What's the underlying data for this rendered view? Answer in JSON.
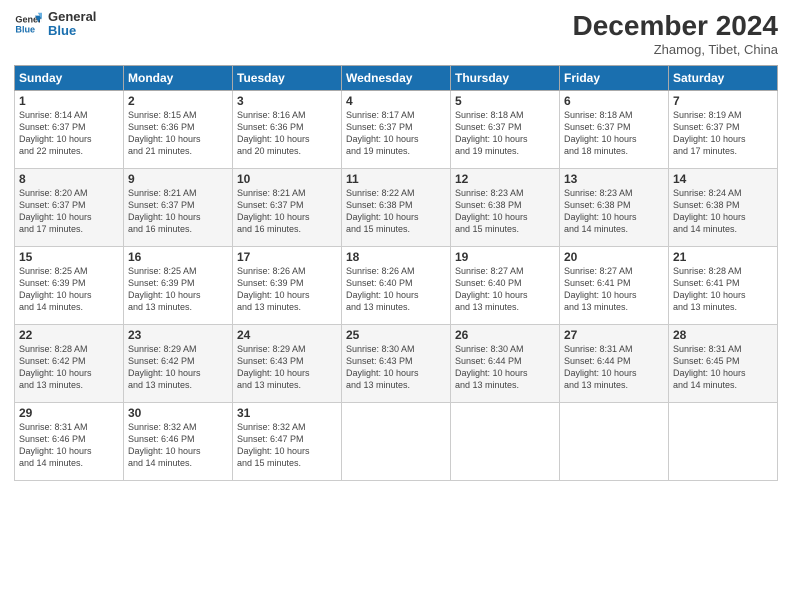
{
  "logo": {
    "line1": "General",
    "line2": "Blue"
  },
  "title": "December 2024",
  "subtitle": "Zhamog, Tibet, China",
  "days_header": [
    "Sunday",
    "Monday",
    "Tuesday",
    "Wednesday",
    "Thursday",
    "Friday",
    "Saturday"
  ],
  "weeks": [
    [
      {
        "day": "1",
        "text": "Sunrise: 8:14 AM\nSunset: 6:37 PM\nDaylight: 10 hours\nand 22 minutes."
      },
      {
        "day": "2",
        "text": "Sunrise: 8:15 AM\nSunset: 6:36 PM\nDaylight: 10 hours\nand 21 minutes."
      },
      {
        "day": "3",
        "text": "Sunrise: 8:16 AM\nSunset: 6:36 PM\nDaylight: 10 hours\nand 20 minutes."
      },
      {
        "day": "4",
        "text": "Sunrise: 8:17 AM\nSunset: 6:37 PM\nDaylight: 10 hours\nand 19 minutes."
      },
      {
        "day": "5",
        "text": "Sunrise: 8:18 AM\nSunset: 6:37 PM\nDaylight: 10 hours\nand 19 minutes."
      },
      {
        "day": "6",
        "text": "Sunrise: 8:18 AM\nSunset: 6:37 PM\nDaylight: 10 hours\nand 18 minutes."
      },
      {
        "day": "7",
        "text": "Sunrise: 8:19 AM\nSunset: 6:37 PM\nDaylight: 10 hours\nand 17 minutes."
      }
    ],
    [
      {
        "day": "8",
        "text": "Sunrise: 8:20 AM\nSunset: 6:37 PM\nDaylight: 10 hours\nand 17 minutes."
      },
      {
        "day": "9",
        "text": "Sunrise: 8:21 AM\nSunset: 6:37 PM\nDaylight: 10 hours\nand 16 minutes."
      },
      {
        "day": "10",
        "text": "Sunrise: 8:21 AM\nSunset: 6:37 PM\nDaylight: 10 hours\nand 16 minutes."
      },
      {
        "day": "11",
        "text": "Sunrise: 8:22 AM\nSunset: 6:38 PM\nDaylight: 10 hours\nand 15 minutes."
      },
      {
        "day": "12",
        "text": "Sunrise: 8:23 AM\nSunset: 6:38 PM\nDaylight: 10 hours\nand 15 minutes."
      },
      {
        "day": "13",
        "text": "Sunrise: 8:23 AM\nSunset: 6:38 PM\nDaylight: 10 hours\nand 14 minutes."
      },
      {
        "day": "14",
        "text": "Sunrise: 8:24 AM\nSunset: 6:38 PM\nDaylight: 10 hours\nand 14 minutes."
      }
    ],
    [
      {
        "day": "15",
        "text": "Sunrise: 8:25 AM\nSunset: 6:39 PM\nDaylight: 10 hours\nand 14 minutes."
      },
      {
        "day": "16",
        "text": "Sunrise: 8:25 AM\nSunset: 6:39 PM\nDaylight: 10 hours\nand 13 minutes."
      },
      {
        "day": "17",
        "text": "Sunrise: 8:26 AM\nSunset: 6:39 PM\nDaylight: 10 hours\nand 13 minutes."
      },
      {
        "day": "18",
        "text": "Sunrise: 8:26 AM\nSunset: 6:40 PM\nDaylight: 10 hours\nand 13 minutes."
      },
      {
        "day": "19",
        "text": "Sunrise: 8:27 AM\nSunset: 6:40 PM\nDaylight: 10 hours\nand 13 minutes."
      },
      {
        "day": "20",
        "text": "Sunrise: 8:27 AM\nSunset: 6:41 PM\nDaylight: 10 hours\nand 13 minutes."
      },
      {
        "day": "21",
        "text": "Sunrise: 8:28 AM\nSunset: 6:41 PM\nDaylight: 10 hours\nand 13 minutes."
      }
    ],
    [
      {
        "day": "22",
        "text": "Sunrise: 8:28 AM\nSunset: 6:42 PM\nDaylight: 10 hours\nand 13 minutes."
      },
      {
        "day": "23",
        "text": "Sunrise: 8:29 AM\nSunset: 6:42 PM\nDaylight: 10 hours\nand 13 minutes."
      },
      {
        "day": "24",
        "text": "Sunrise: 8:29 AM\nSunset: 6:43 PM\nDaylight: 10 hours\nand 13 minutes."
      },
      {
        "day": "25",
        "text": "Sunrise: 8:30 AM\nSunset: 6:43 PM\nDaylight: 10 hours\nand 13 minutes."
      },
      {
        "day": "26",
        "text": "Sunrise: 8:30 AM\nSunset: 6:44 PM\nDaylight: 10 hours\nand 13 minutes."
      },
      {
        "day": "27",
        "text": "Sunrise: 8:31 AM\nSunset: 6:44 PM\nDaylight: 10 hours\nand 13 minutes."
      },
      {
        "day": "28",
        "text": "Sunrise: 8:31 AM\nSunset: 6:45 PM\nDaylight: 10 hours\nand 14 minutes."
      }
    ],
    [
      {
        "day": "29",
        "text": "Sunrise: 8:31 AM\nSunset: 6:46 PM\nDaylight: 10 hours\nand 14 minutes."
      },
      {
        "day": "30",
        "text": "Sunrise: 8:32 AM\nSunset: 6:46 PM\nDaylight: 10 hours\nand 14 minutes."
      },
      {
        "day": "31",
        "text": "Sunrise: 8:32 AM\nSunset: 6:47 PM\nDaylight: 10 hours\nand 15 minutes."
      },
      null,
      null,
      null,
      null
    ]
  ]
}
